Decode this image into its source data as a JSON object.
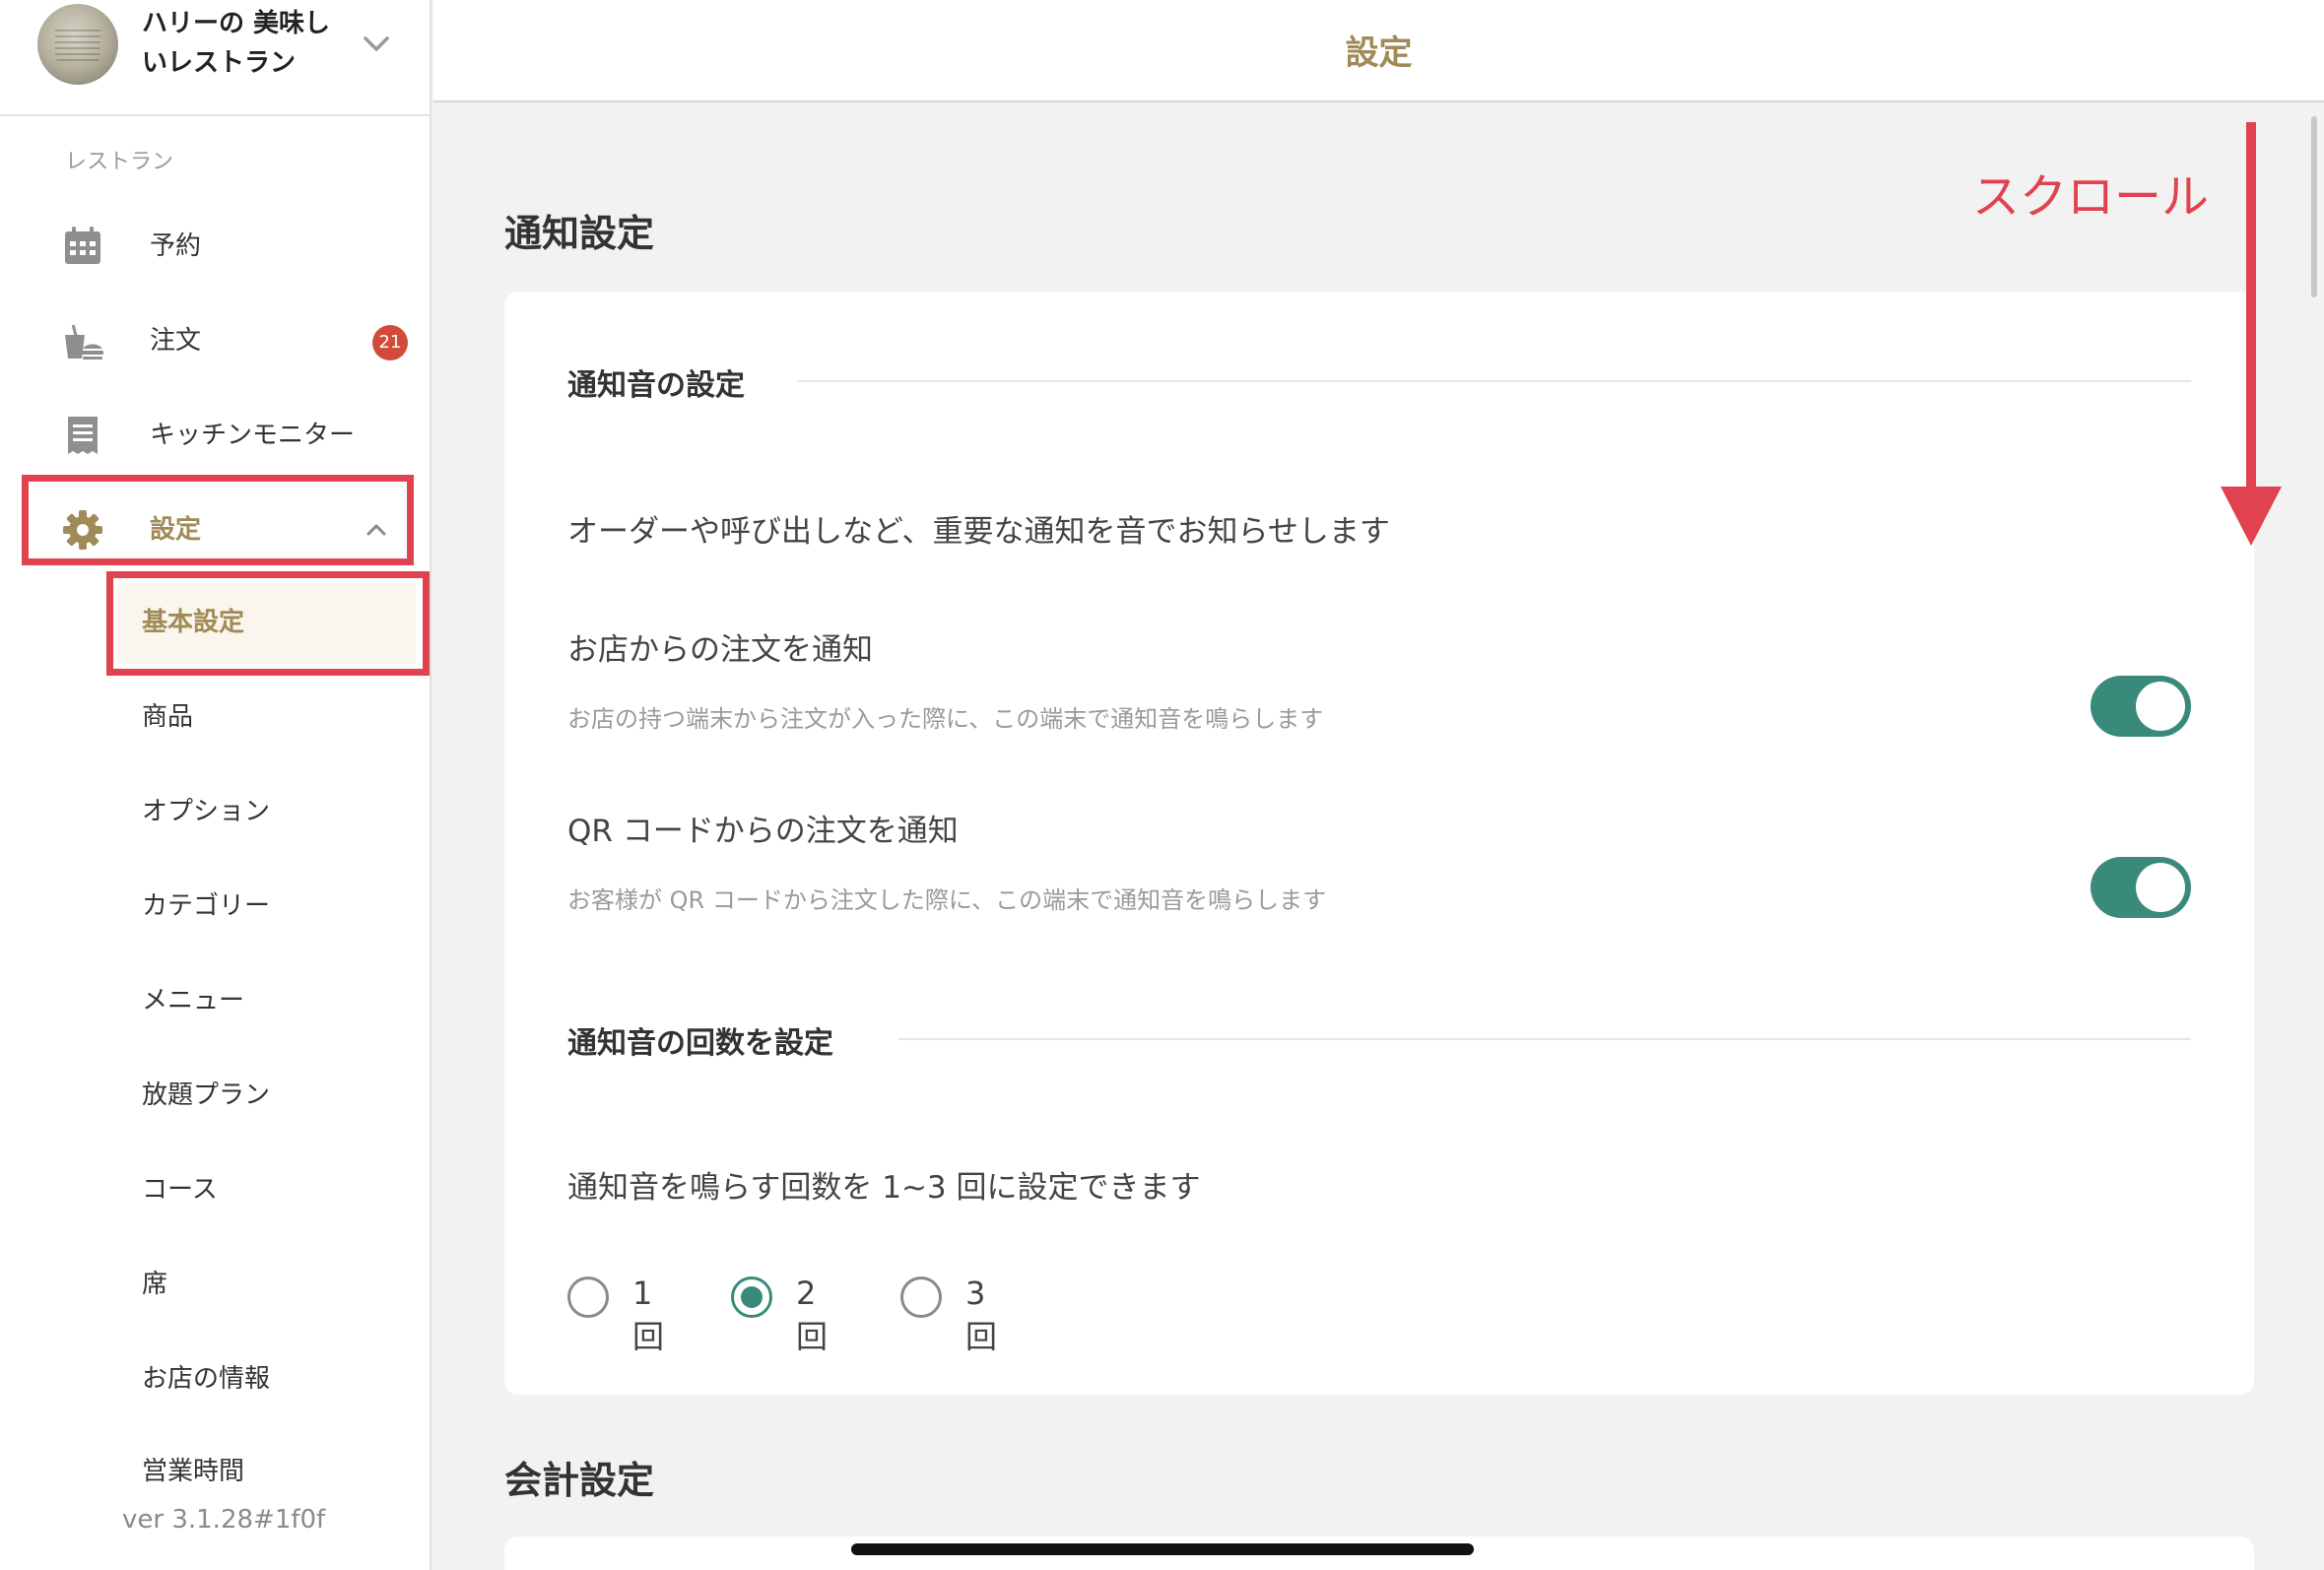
{
  "sidebar": {
    "store_name": "ハリーの 美味しいレストラン",
    "section_label": "レストラン",
    "nav": [
      {
        "label": "予約",
        "icon": "calendar-icon"
      },
      {
        "label": "注文",
        "icon": "order-icon",
        "badge": "21"
      },
      {
        "label": "キッチンモニター",
        "icon": "receipt-icon"
      },
      {
        "label": "設定",
        "icon": "gear-icon",
        "expanded": true
      }
    ],
    "sub_items": [
      {
        "label": "基本設定",
        "active": true
      },
      {
        "label": "商品"
      },
      {
        "label": "オプション"
      },
      {
        "label": "カテゴリー"
      },
      {
        "label": "メニュー"
      },
      {
        "label": "放題プラン"
      },
      {
        "label": "コース"
      },
      {
        "label": "席"
      },
      {
        "label": "お店の情報"
      },
      {
        "label": "営業時間"
      }
    ],
    "version": "ver 3.1.28#1f0f"
  },
  "header": {
    "title": "設定"
  },
  "main": {
    "notification_title": "通知設定",
    "sound_section": {
      "heading": "通知音の設定",
      "description": "オーダーや呼び出しなど、重要な通知を音でお知らせします",
      "options": [
        {
          "title": "お店からの注文を通知",
          "subtitle": "お店の持つ端末から注文が入った際に、この端末で通知音を鳴らします",
          "enabled": true
        },
        {
          "title": "QR コードからの注文を通知",
          "subtitle": "お客様が QR コードから注文した際に、この端末で通知音を鳴らします",
          "enabled": true
        }
      ]
    },
    "count_section": {
      "heading": "通知音の回数を設定",
      "description": "通知音を鳴らす回数を 1~3 回に設定できます",
      "choices": [
        "1回",
        "2回",
        "3回"
      ],
      "selected": "2回"
    },
    "accounting_title": "会計設定"
  },
  "annotation": {
    "scroll_label": "スクロール",
    "color": "#e0434f"
  },
  "colors": {
    "accent": "#a08a57",
    "toggle_on": "#3a8a7c",
    "badge": "#d24b3a"
  }
}
